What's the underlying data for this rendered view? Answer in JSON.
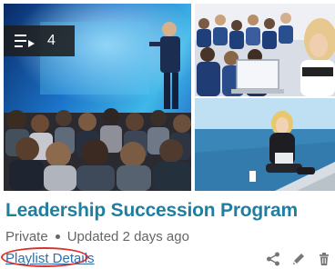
{
  "playlist": {
    "item_count": "4",
    "title": "Leadership Succession Program",
    "visibility": "Private",
    "updated": "Updated 2 days ago",
    "details_link": "Playlist Details"
  },
  "icons": {
    "badge": "playlist-icon",
    "share": "share-icon",
    "edit": "pencil-icon",
    "delete": "trash-icon"
  },
  "colors": {
    "title": "#1f7fa0",
    "link": "#2f6fa8",
    "annotation": "#d9302c",
    "meta": "#666666"
  }
}
